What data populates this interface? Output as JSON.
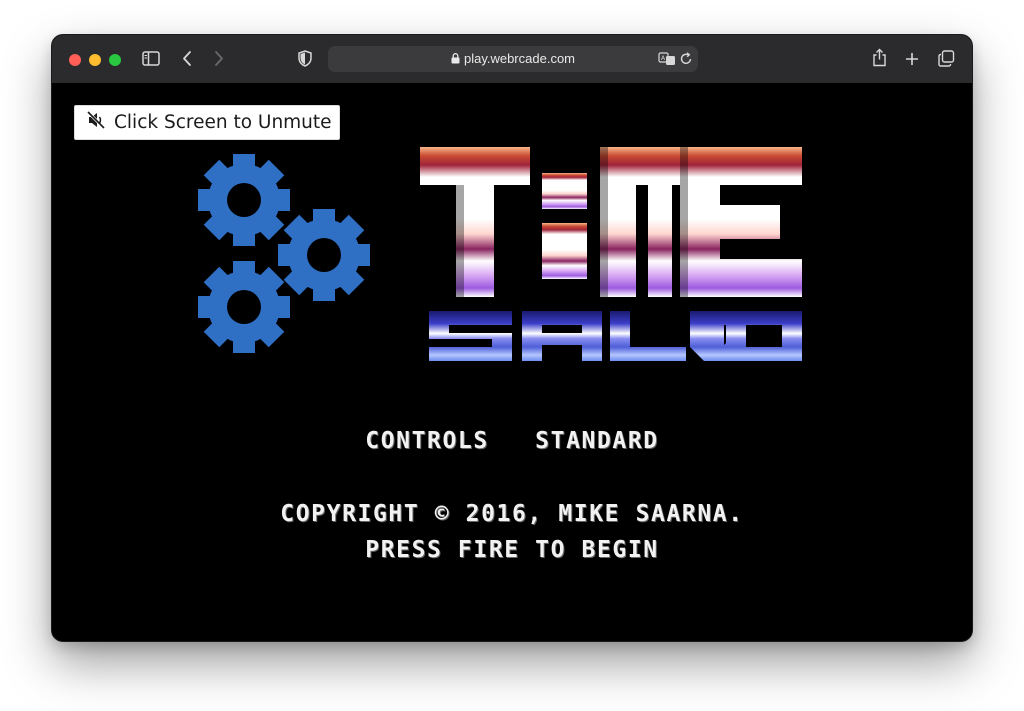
{
  "browser": {
    "url": "play.webrcade.com"
  },
  "overlay": {
    "unmute_label": "Click Screen to Unmute"
  },
  "game": {
    "logo_title": "T:ME",
    "logo_subtitle": "SALVO",
    "controls_line": "CONTROLS   STANDARD",
    "copyright_line": "COPYRIGHT © 2016, MIKE SAARNA.",
    "start_prompt": "PRESS FIRE TO BEGIN"
  },
  "colors": {
    "gear_blue": "#2f6fc4",
    "toolbar_bg": "#2b2b2d",
    "address_bg": "#3b3b3d"
  },
  "icons": [
    "sidebar-icon",
    "back-icon",
    "forward-icon",
    "shield-icon",
    "lock-icon",
    "translate-icon",
    "reload-icon",
    "share-icon",
    "new-tab-icon",
    "tabs-overview-icon",
    "speaker-muted-icon",
    "gear-icon"
  ]
}
